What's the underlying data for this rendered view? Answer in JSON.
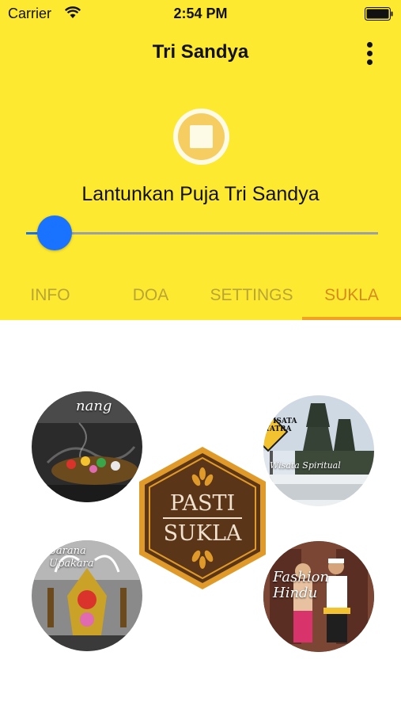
{
  "status_bar": {
    "carrier": "Carrier",
    "time": "2:54 PM"
  },
  "app_bar": {
    "title": "Tri Sandya",
    "menu_icon": "more-vertical-icon"
  },
  "player": {
    "stop_icon": "stop-icon",
    "track_title": "Lantunkan Puja Tri Sandya",
    "progress": 0.08
  },
  "tabs": [
    {
      "label": "INFO",
      "active": false
    },
    {
      "label": "DOA",
      "active": false
    },
    {
      "label": "SETTINGS",
      "active": false
    },
    {
      "label": "SUKLA",
      "active": true
    }
  ],
  "sukla": {
    "logo": {
      "line1": "PASTI",
      "line2": "SUKLA"
    },
    "circles": [
      {
        "name": "banten-harian-image",
        "caption": "nang"
      },
      {
        "name": "wisata-spiritual-image",
        "caption": "Wisata Spiritual",
        "sign": "WISATA YATRA"
      },
      {
        "name": "sarana-upakara-image",
        "caption": "Sarana Upakara"
      },
      {
        "name": "fashion-hindu-image",
        "caption": "Fashion Hindu"
      }
    ]
  },
  "colors": {
    "header_bg": "#fde930",
    "tab_inactive": "#b9a436",
    "tab_active": "#d8891f",
    "indicator": "#f2a21e",
    "slider_thumb": "#1a73ff",
    "logo_brown": "#5a3518",
    "logo_orange": "#e09a2a"
  }
}
